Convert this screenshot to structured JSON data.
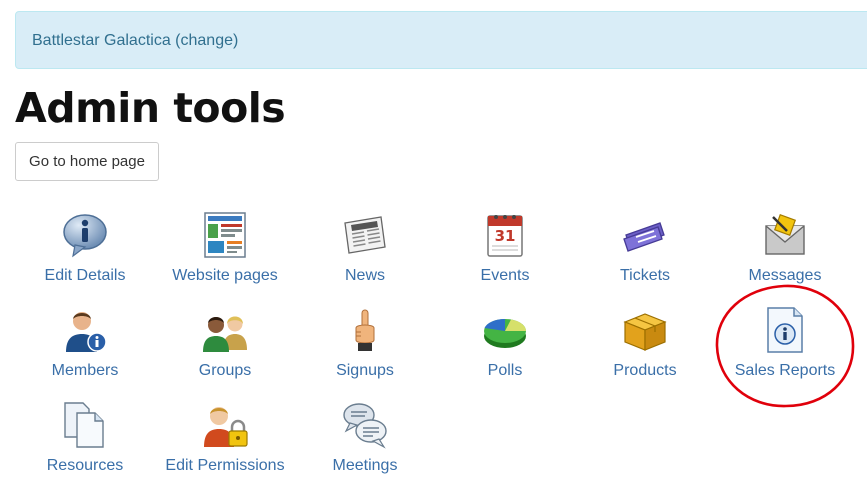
{
  "context": {
    "selector_link": "Battlestar Galactica (change)"
  },
  "page": {
    "title": "Admin tools"
  },
  "actions": {
    "home_button": "Go to home page"
  },
  "tools": [
    {
      "label": "Edit Details",
      "icon": "info-bubble-icon"
    },
    {
      "label": "Website pages",
      "icon": "website-pages-icon"
    },
    {
      "label": "News",
      "icon": "newspaper-icon"
    },
    {
      "label": "Events",
      "icon": "calendar-icon"
    },
    {
      "label": "Tickets",
      "icon": "ticket-icon"
    },
    {
      "label": "Messages",
      "icon": "envelope-icon"
    },
    {
      "label": "Members",
      "icon": "member-info-icon"
    },
    {
      "label": "Groups",
      "icon": "group-people-icon"
    },
    {
      "label": "Signups",
      "icon": "pointing-hand-icon"
    },
    {
      "label": "Polls",
      "icon": "pie-chart-icon"
    },
    {
      "label": "Products",
      "icon": "box-icon"
    },
    {
      "label": "Sales Reports",
      "icon": "info-document-icon"
    },
    {
      "label": "Resources",
      "icon": "documents-icon"
    },
    {
      "label": "Edit Permissions",
      "icon": "user-lock-icon"
    },
    {
      "label": "Meetings",
      "icon": "speech-bubbles-icon"
    }
  ],
  "colors": {
    "alert_bg": "#d9edf7",
    "link": "#3a6fa8",
    "annotation_circle": "#e0000b"
  }
}
